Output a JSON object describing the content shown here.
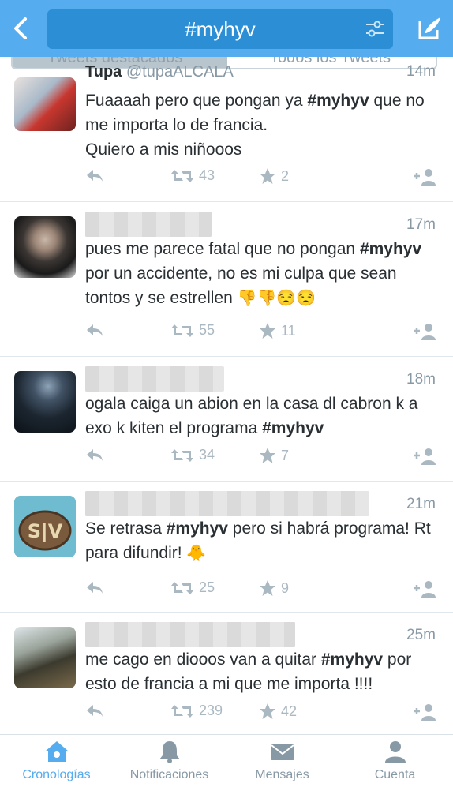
{
  "header": {
    "search_query": "#myhyv",
    "back_icon": "chevron-left-icon",
    "filter_icon": "sliders-icon",
    "compose_icon": "compose-feather-icon",
    "accent": "#55acee",
    "segment_left": "Tweets destacados",
    "segment_right": "Todos los Tweets"
  },
  "tweets": [
    {
      "name": "Tupa",
      "handle": "@tupaALCALA",
      "time": "14m",
      "text_a": "Fuaaaah pero que pongan ya ",
      "hashtag": "#myhyv",
      "text_b": " que no me importa lo de francia.",
      "text_c": "Quiero a mis niñooos",
      "retweets": "43",
      "favorites": "2"
    },
    {
      "time": "17m",
      "text_a": "pues me parece fatal que no pongan ",
      "hashtag": "#myhyv",
      "text_b": " por un accidente, no es mi culpa que sean tontos y se estrellen ",
      "emoji": "👎👎😒😒",
      "retweets": "55",
      "favorites": "11"
    },
    {
      "time": "18m",
      "text_a": "ogala caiga un abion en la casa dl cabron k a exo k kiten el programa ",
      "hashtag": "#myhyv",
      "retweets": "34",
      "favorites": "7"
    },
    {
      "time": "21m",
      "text_a": "Se retrasa ",
      "hashtag": "#myhyv",
      "text_b": " pero si habrá programa! Rt para difundir! ",
      "emoji": "🐥",
      "retweets": "25",
      "favorites": "9"
    },
    {
      "time": "25m",
      "text_a": "me cago en diooos van a quitar ",
      "hashtag": "#myhyv",
      "text_b": " por esto de francia a mi que me importa !!!!",
      "retweets": "239",
      "favorites": "42"
    }
  ],
  "tabbar": {
    "tabs": [
      {
        "label": "Cronologías",
        "icon": "home-icon"
      },
      {
        "label": "Notificaciones",
        "icon": "bell-icon"
      },
      {
        "label": "Mensajes",
        "icon": "envelope-icon"
      },
      {
        "label": "Cuenta",
        "icon": "person-icon"
      }
    ],
    "active_color": "#55acee",
    "inactive_color": "#8899a6"
  }
}
